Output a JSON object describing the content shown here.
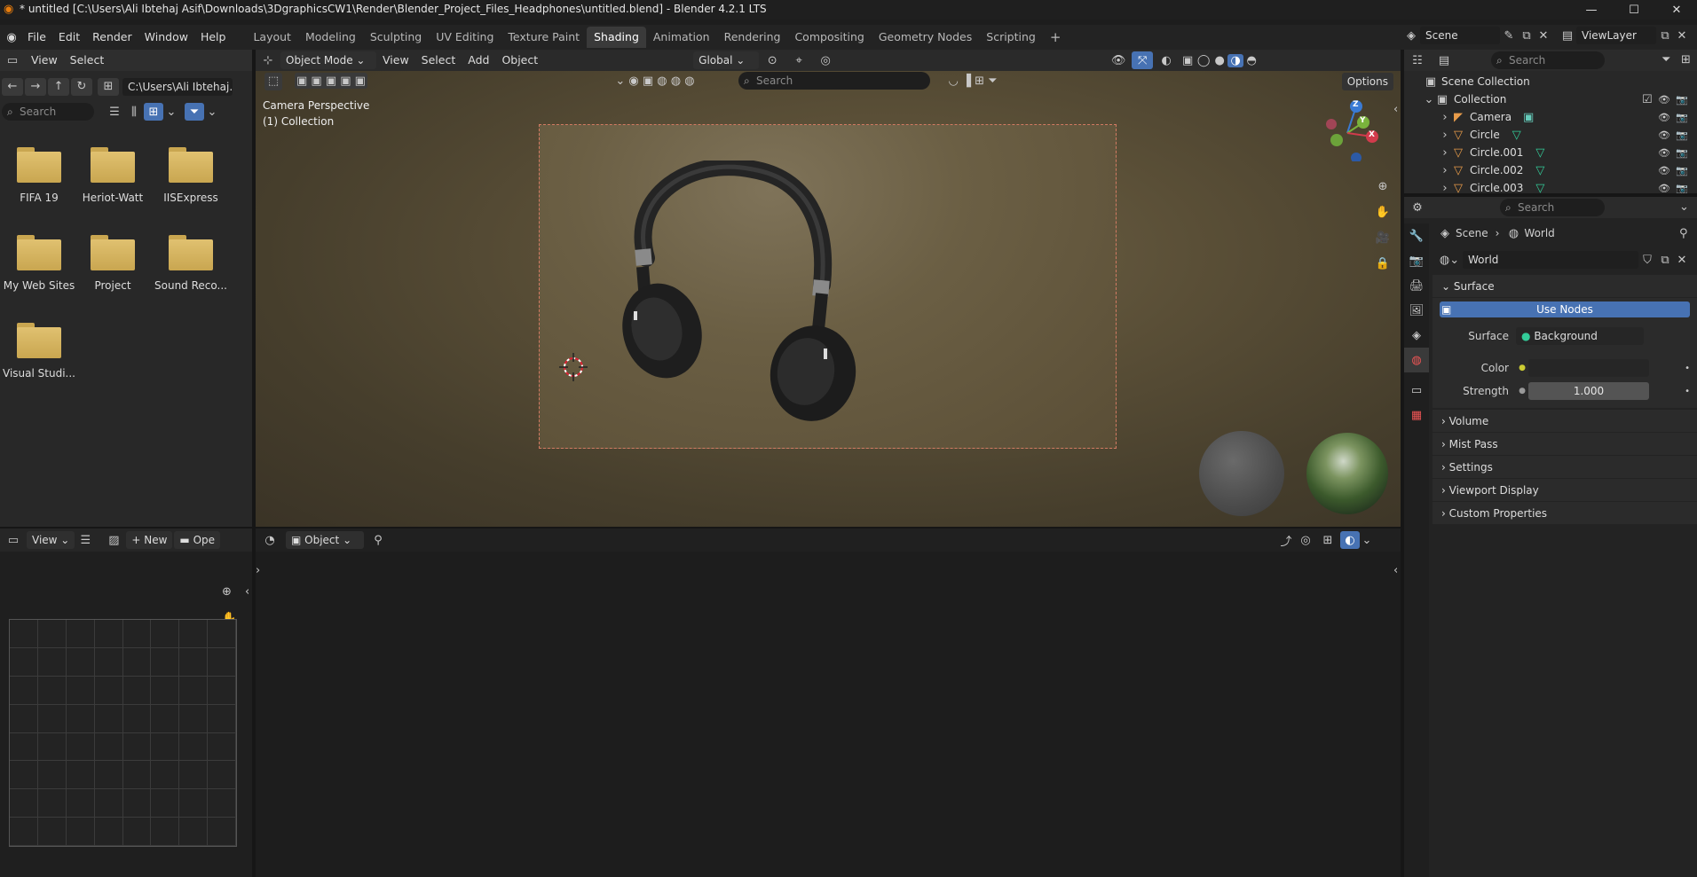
{
  "window": {
    "title": "* untitled [C:\\Users\\Ali Ibtehaj Asif\\Downloads\\3DgraphicsCW1\\Render\\Blender_Project_Files_Headphones\\untitled.blend] - Blender 4.2.1 LTS",
    "minimize": "—",
    "maximize": "☐",
    "close": "✕"
  },
  "menu": [
    "File",
    "Edit",
    "Render",
    "Window",
    "Help"
  ],
  "workspaces": [
    "Layout",
    "Modeling",
    "Sculpting",
    "UV Editing",
    "Texture Paint",
    "Shading",
    "Animation",
    "Rendering",
    "Compositing",
    "Geometry Nodes",
    "Scripting"
  ],
  "active_workspace": "Shading",
  "scene_selector": {
    "scene": "Scene",
    "view_layer": "ViewLayer"
  },
  "file_browser": {
    "menus": [
      "View",
      "Select"
    ],
    "path": "C:\\Users\\Ali Ibtehaj...",
    "search_placeholder": "Search",
    "folders": [
      "FIFA 19",
      "Heriot-Watt",
      "IISExpress",
      "My Web Sites",
      "Project",
      "Sound Reco...",
      "Visual Studi..."
    ]
  },
  "viewport": {
    "mode": "Object Mode",
    "menus": [
      "View",
      "Select",
      "Add",
      "Object"
    ],
    "orientation": "Global",
    "options": "Options",
    "search_placeholder": "Search",
    "overlay_text_1": "Camera Perspective",
    "overlay_text_2": "(1) Collection",
    "gizmo": {
      "z": "Z",
      "y": "Y",
      "x": "X"
    }
  },
  "image_editor": {
    "view": "View",
    "new": "New",
    "open": "Ope"
  },
  "node_editor": {
    "object": "Object"
  },
  "outliner": {
    "search_placeholder": "Search",
    "scene_collection": "Scene Collection",
    "collection": "Collection",
    "items": [
      "Camera",
      "Circle",
      "Circle.001",
      "Circle.002",
      "Circle.003"
    ]
  },
  "properties": {
    "search_placeholder": "Search",
    "breadcrumb_scene": "Scene",
    "breadcrumb_world": "World",
    "world_name": "World",
    "sections": {
      "surface": "Surface",
      "use_nodes": "Use Nodes",
      "surface_label": "Surface",
      "surface_value": "Background",
      "color_label": "Color",
      "strength_label": "Strength",
      "strength_value": "1.000",
      "collapsed": [
        "Volume",
        "Mist Pass",
        "Settings",
        "Viewport Display",
        "Custom Properties"
      ]
    }
  },
  "colors": {
    "accent_blue": "#4772b3",
    "folder_yellow": "#d6b762",
    "camera_frame": "#d27a62"
  }
}
